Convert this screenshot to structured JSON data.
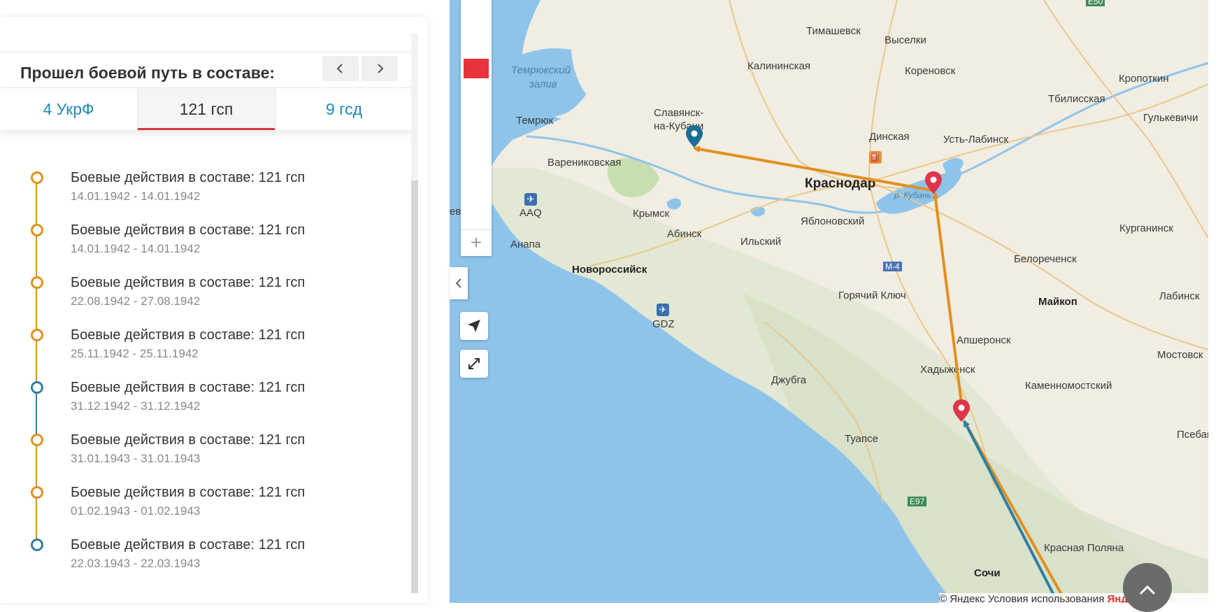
{
  "panel": {
    "title": "Прошел боевой путь в составе:",
    "prev_icon": "chevron-left-icon",
    "next_icon": "chevron-right-icon",
    "tabs": [
      {
        "label": "4 УкрФ",
        "active": false
      },
      {
        "label": "121 гсп",
        "active": true
      },
      {
        "label": "9 гсд",
        "active": false
      }
    ]
  },
  "timeline": [
    {
      "text": "Боевые действия в составе: 121 гсп",
      "date": "14.01.1942 - 14.01.1942",
      "color": "#e0901f"
    },
    {
      "text": "Боевые действия в составе: 121 гсп",
      "date": "14.01.1942 - 14.01.1942",
      "color": "#e0901f"
    },
    {
      "text": "Боевые действия в составе: 121 гсп",
      "date": "22.08.1942 - 27.08.1942",
      "color": "#e0901f"
    },
    {
      "text": "Боевые действия в составе: 121 гсп",
      "date": "25.11.1942 - 25.11.1942",
      "color": "#e0901f"
    },
    {
      "text": "Боевые действия в составе: 121 гсп",
      "date": "31.12.1942 - 31.12.1942",
      "color": "#2e7fa3"
    },
    {
      "text": "Боевые действия в составе: 121 гсп",
      "date": "31.01.1943 - 31.01.1943",
      "color": "#e0901f"
    },
    {
      "text": "Боевые действия в составе: 121 гсп",
      "date": "01.02.1943 - 01.02.1943",
      "color": "#e0901f"
    },
    {
      "text": "Боевые действия в составе: 121 гсп",
      "date": "22.03.1943 - 22.03.1943",
      "color": "#2e7fa3"
    }
  ],
  "map": {
    "places": {
      "timashevsk": "Тимашевск",
      "vyselki": "Выселки",
      "kalininskaya": "Калининская",
      "korenovsk": "Кореновск",
      "kropotkin": "Кропоткин",
      "tbilisskaya": "Тбилисская",
      "gulkevichi": "Гулькевичи",
      "temryuk_bay_1": "Темрюкский",
      "temryuk_bay_2": "залив",
      "temryuk": "Темрюк",
      "slavyansk_1": "Славянск-",
      "slavyansk_2": "на-Кубани",
      "dinskaya": "Динская",
      "ust_labinsk": "Усть-Лабинск",
      "varenikovskaya": "Варениковская",
      "krasnodar": "Краснодар",
      "krymsk": "Крымск",
      "aaq": "AAQ",
      "evo": "ево",
      "yablonovsky": "Яблоновский",
      "kurganinsk": "Курганинск",
      "anapa": "Анапа",
      "abinsk": "Абинск",
      "ilsky": "Ильский",
      "novorossiysk": "Новороссийск",
      "m4": "M-4",
      "belorechensk": "Белореченск",
      "goryachy_klyuch": "Горячий Ключ",
      "maikop": "Майкоп",
      "labinsk": "Лабинск",
      "gdz": "GDZ",
      "apsheronsk": "Апшеронск",
      "khadyzhensk": "Хадыженск",
      "mostovskoy": "Мостовск",
      "dzhubga": "Джубга",
      "kamennomostsky": "Каменномостский",
      "tuapse": "Туапсе",
      "psebai": "Псебай",
      "e97": "E97",
      "e50": "E50",
      "krasnaya_polyana": "Красная Поляна",
      "sochi": "Сочи",
      "kuban_river": "р. Кубань"
    },
    "copyright": "© Яндекс Условия использования",
    "brand": "Яндекс",
    "selected_color": "#e8323c",
    "zoom_in_label": "+",
    "geolocation_icon": "navigation-arrow-icon",
    "fullscreen_icon": "expand-icon",
    "collapse_icon": "chevron-left-icon",
    "up_icon": "chevron-up-icon"
  }
}
